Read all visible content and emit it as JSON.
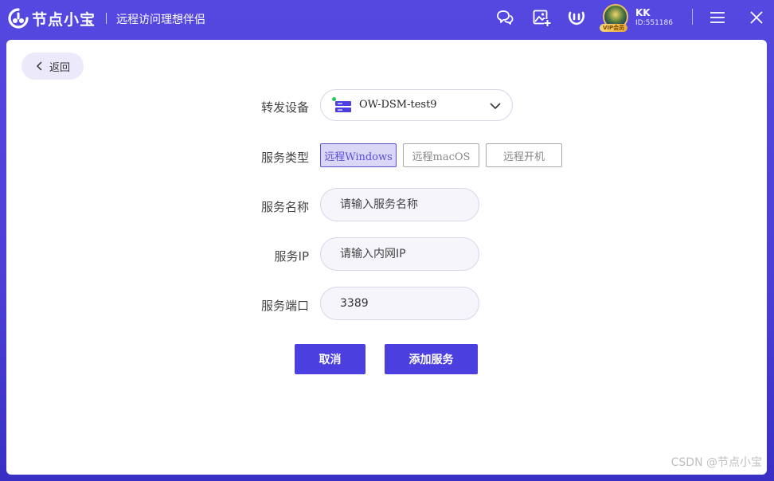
{
  "titlebar": {
    "app_name": "节点小宝",
    "slogan": "远程访问理想伴侣",
    "user_name": "KK",
    "user_id": "ID:551186",
    "vip_label": "VIP会员"
  },
  "back_label": "返回",
  "form": {
    "device_label": "转发设备",
    "device_value": "OW-DSM-test9",
    "service_type_label": "服务类型",
    "service_types": [
      "远程Windows",
      "远程macOS",
      "远程开机"
    ],
    "service_name_label": "服务名称",
    "service_name_placeholder": "请输入服务名称",
    "service_ip_label": "服务IP",
    "service_ip_placeholder": "请输入内网IP",
    "service_port_label": "服务端口",
    "service_port_value": "3389"
  },
  "actions": {
    "cancel_label": "取消",
    "add_label": "添加服务"
  },
  "watermark": "CSDN @节点小宝",
  "icons": [
    "logo-icon",
    "chat-icon",
    "image-add-icon",
    "app-logo-icon",
    "menu-icon",
    "close-icon",
    "back-chevron-icon",
    "server-icon",
    "chevron-down-icon"
  ],
  "colors": {
    "accent": "#4b3fe0",
    "active_tab_bg": "#d9d6f6",
    "status_online": "#22c55e"
  }
}
